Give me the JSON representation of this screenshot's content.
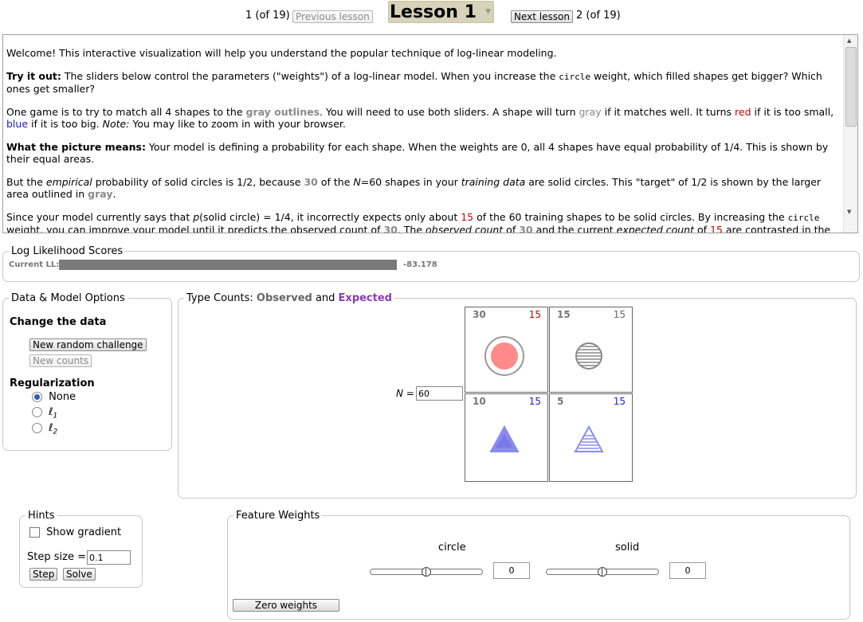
{
  "nav": {
    "prev_count": "1 (of 19)",
    "prev_label": "Previous lesson",
    "lesson_title": "Lesson 1",
    "next_label": "Next lesson",
    "next_count": "2 (of 19)"
  },
  "intro": {
    "p1": "Welcome! This interactive visualization will help you understand the popular technique of log-linear modeling.",
    "p2_bold": "Try it out:",
    "p2_a": " The sliders below control the parameters (\"weights\") of a log-linear model. When you increase the ",
    "p2_code": "circle",
    "p2_b": " weight, which filled shapes get bigger? Which ones get smaller?",
    "p3_a": "One game is to try to match all 4 shapes to the ",
    "p3_gray_outlines": "gray outlines",
    "p3_b": ". You will need to use both sliders. A shape will turn ",
    "p3_gray": "gray",
    "p3_c": " if it matches well. It turns ",
    "p3_red": "red",
    "p3_d": " if it is too small, ",
    "p3_blue": "blue",
    "p3_e": " if it is too big. ",
    "p3_note": "Note:",
    "p3_f": " You may like to zoom in with your browser.",
    "p4_bold": "What the picture means:",
    "p4_a": " Your model is defining a probability for each shape. When the weights are 0, all 4 shapes have equal probability of 1/4. This is shown by their equal areas.",
    "p5_a": "But the ",
    "p5_emp": "empirical",
    "p5_b": " probability of solid circles is 1/2, because ",
    "p5_30": "30",
    "p5_c": " of the ",
    "p5_N": "N",
    "p5_d": "=60 shapes in your ",
    "p5_train": "training data",
    "p5_e": " are solid circles. This \"target\" of 1/2 is shown by the larger area outlined in ",
    "p5_gray": "gray",
    "p5_f": ".",
    "p6_a": "Since your model currently says that ",
    "p6_p": "p",
    "p6_b": "(solid circle) = 1/4, it incorrectly expects only about ",
    "p6_15": "15",
    "p6_c": " of the 60 training shapes to be solid circles. By increasing the ",
    "p6_code": "circle",
    "p6_d": " weight, you can improve your model until it predicts the observed count of ",
    "p6_30": "30",
    "p6_e": ". The ",
    "p6_obs": "observed count",
    "p6_f": " of ",
    "p6_30b": "30",
    "p6_g": " and the current ",
    "p6_exp": "expected count",
    "p6_h": " of ",
    "p6_15b": "15",
    "p6_i": " are contrasted in the solid circle box."
  },
  "ll": {
    "legend": "Log Likelihood Scores",
    "label": "Current LL:",
    "value": "-83.178"
  },
  "options": {
    "legend": "Data & Model Options",
    "change_heading": "Change the data",
    "new_challenge": "New random challenge",
    "new_counts": "New counts",
    "reg_heading": "Regularization",
    "reg_none": "None",
    "reg_l1": "ℓ",
    "reg_l1_sub": "1",
    "reg_l2": "ℓ",
    "reg_l2_sub": "2"
  },
  "counts": {
    "legend_prefix": "Type Counts: ",
    "legend_observed": "Observed",
    "legend_and": " and ",
    "legend_expected": "Expected",
    "n_label": "N",
    "n_eq": " = ",
    "n_value": "60",
    "cells": [
      {
        "observed": "30",
        "expected": "15",
        "shape": "solid-circle",
        "expected_color": "#cc0000"
      },
      {
        "observed": "15",
        "expected": "15",
        "shape": "striped-circle",
        "expected_color": "#666666"
      },
      {
        "observed": "10",
        "expected": "15",
        "shape": "solid-triangle",
        "expected_color": "#1a1ad0"
      },
      {
        "observed": "5",
        "expected": "15",
        "shape": "striped-triangle",
        "expected_color": "#1a1ad0"
      }
    ]
  },
  "hints": {
    "legend": "Hints",
    "show_gradient": "Show gradient",
    "step_size_label": "Step size = ",
    "step_size_value": "0.1",
    "step": "Step",
    "solve": "Solve"
  },
  "weights": {
    "legend": "Feature Weights",
    "circle_label": "circle",
    "circle_value": "0",
    "solid_label": "solid",
    "solid_value": "0",
    "zero": "Zero weights"
  },
  "colors": {
    "fill_red": "#ff8a8a",
    "fill_blue": "#8a8af0",
    "outline_gray": "#999999",
    "ll_bar": "#7a7a7a",
    "expected_purple": "#8b3ab8"
  }
}
